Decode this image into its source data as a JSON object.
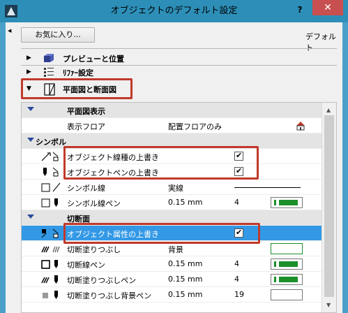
{
  "window": {
    "title": "オブジェクトのデフォルト設定",
    "help_glyph": "?",
    "close_glyph": "✕"
  },
  "toolbar": {
    "favorites_label": "お気に入り...",
    "default_label": "デフォルト"
  },
  "sections": [
    {
      "label": "プレビューと位置",
      "icon": "preview-icon"
    },
    {
      "label": "ﾘﾌｧｰ設定",
      "icon": "layer-settings-icon"
    },
    {
      "label": "平面図と断面図",
      "icon": "floor-plan-section-icon"
    }
  ],
  "grid": {
    "group_plan_display": "平面図表示",
    "row_display_floor": {
      "name": "表示フロア",
      "value": "配置フロアのみ"
    },
    "group_symbol": "シンボル",
    "row_override_linetype": {
      "name": "オブジェクト線種の上書き",
      "checked": true
    },
    "row_override_pen": {
      "name": "オブジェクトペンの上書き",
      "checked": true
    },
    "row_symbol_line": {
      "name": "シンボル線",
      "value": "実線"
    },
    "row_symbol_pen": {
      "name": "シンボル線ペン",
      "value": "0.15 mm",
      "pen_number": "4",
      "pen_color": "#1b8f2a"
    },
    "group_cut": "切断面",
    "row_override_attrs": {
      "name": "オブジェクト属性の上書き",
      "checked": true
    },
    "row_cut_fill": {
      "name": "切断塗りつぶし",
      "value": "背景"
    },
    "row_cut_line_pen": {
      "name": "切断線ペン",
      "value": "0.15 mm",
      "pen_number": "4",
      "pen_color": "#1b8f2a"
    },
    "row_cut_fill_pen": {
      "name": "切断塗りつぶしペン",
      "value": "0.15 mm",
      "pen_number": "4",
      "pen_color": "#1b8f2a"
    },
    "row_cut_fill_bg_pen": {
      "name": "切断塗りつぶし背景ペン",
      "value": "0.15 mm",
      "pen_number": "19"
    }
  },
  "colors": {
    "titlebar": "#2d8fb8",
    "close_button": "#c74f4f",
    "selection": "#3399e6",
    "highlight_box": "#c0392b",
    "pen_green": "#1b8f2a"
  }
}
